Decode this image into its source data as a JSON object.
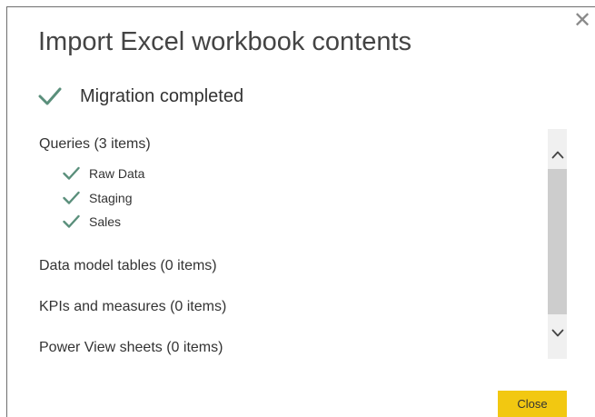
{
  "dialog": {
    "title": "Import Excel workbook contents",
    "close_glyph": "✕",
    "status": {
      "icon": "check-icon",
      "text": "Migration completed",
      "check_color": "#5a8f7b"
    },
    "sections": {
      "queries": {
        "heading": "Queries (3 items)",
        "items": [
          {
            "label": "Raw Data",
            "icon": "check-icon"
          },
          {
            "label": "Staging",
            "icon": "check-icon"
          },
          {
            "label": "Sales",
            "icon": "check-icon"
          }
        ]
      },
      "data_model": {
        "heading": "Data model tables (0 items)"
      },
      "kpis": {
        "heading": "KPIs and measures (0 items)"
      },
      "power_view": {
        "heading": "Power View sheets (0 items)"
      }
    },
    "scrollbar": {
      "up_icon": "chevron-up-icon",
      "down_icon": "chevron-down-icon"
    },
    "footer": {
      "close_label": "Close",
      "close_color": "#f2c811"
    }
  }
}
